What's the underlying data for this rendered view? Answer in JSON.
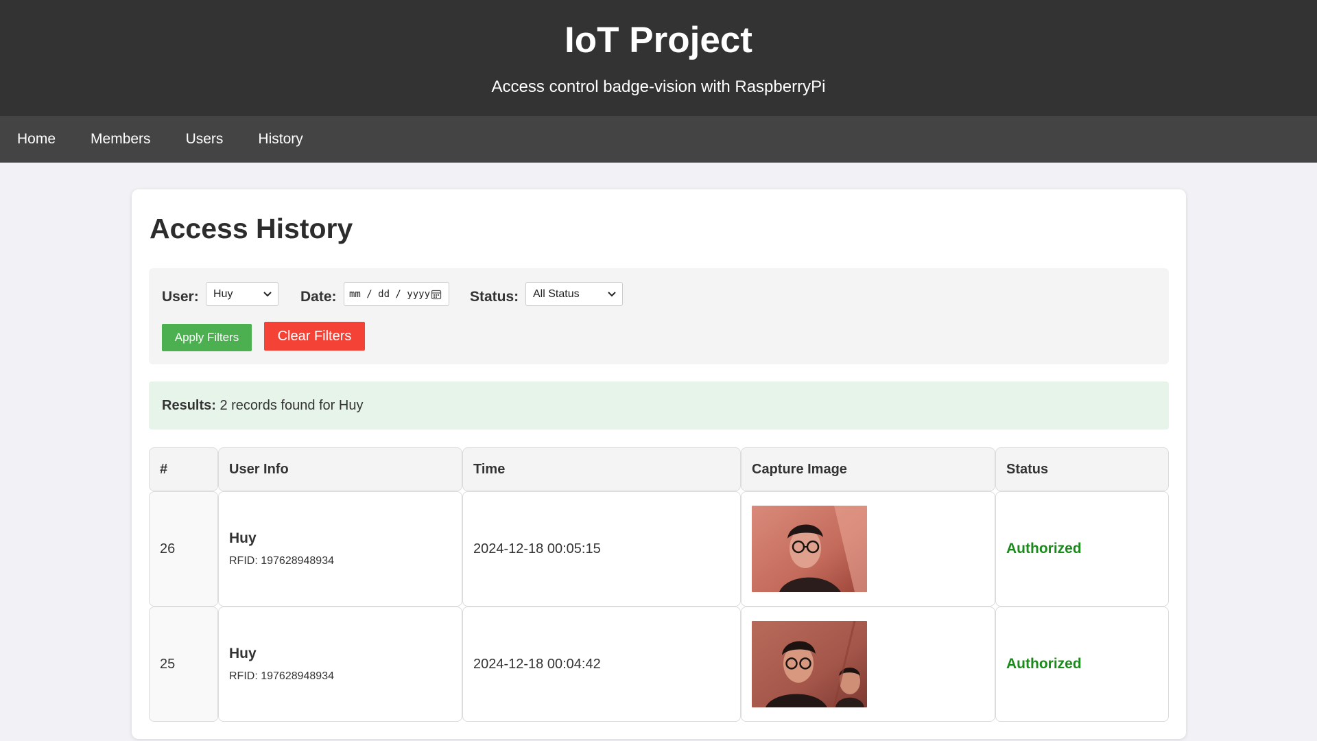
{
  "header": {
    "title": "IoT Project",
    "subtitle": "Access control badge-vision with RaspberryPi"
  },
  "nav": {
    "items": [
      {
        "label": "Home"
      },
      {
        "label": "Members"
      },
      {
        "label": "Users"
      },
      {
        "label": "History"
      }
    ]
  },
  "page": {
    "title": "Access History"
  },
  "filters": {
    "user_label": "User:",
    "user_value": "Huy",
    "date_label": "Date:",
    "date_placeholder": "mm / dd / yyyy",
    "status_label": "Status:",
    "status_value": "All Status",
    "apply_label": "Apply Filters",
    "clear_label": "Clear Filters"
  },
  "results": {
    "label": "Results:",
    "text": "2 records found for Huy"
  },
  "table": {
    "headers": [
      "#",
      "User Info",
      "Time",
      "Capture Image",
      "Status"
    ],
    "rows": [
      {
        "id": "26",
        "name": "Huy",
        "rfid": "RFID: 197628948934",
        "time": "2024-12-18 00:05:15",
        "status": "Authorized"
      },
      {
        "id": "25",
        "name": "Huy",
        "rfid": "RFID: 197628948934",
        "time": "2024-12-18 00:04:42",
        "status": "Authorized"
      }
    ]
  },
  "colors": {
    "header_bg": "#333333",
    "nav_bg": "#444444",
    "apply": "#4caf50",
    "clear": "#f44336",
    "authorized": "#1a8a1a",
    "results_bg": "#e6f4ea"
  }
}
